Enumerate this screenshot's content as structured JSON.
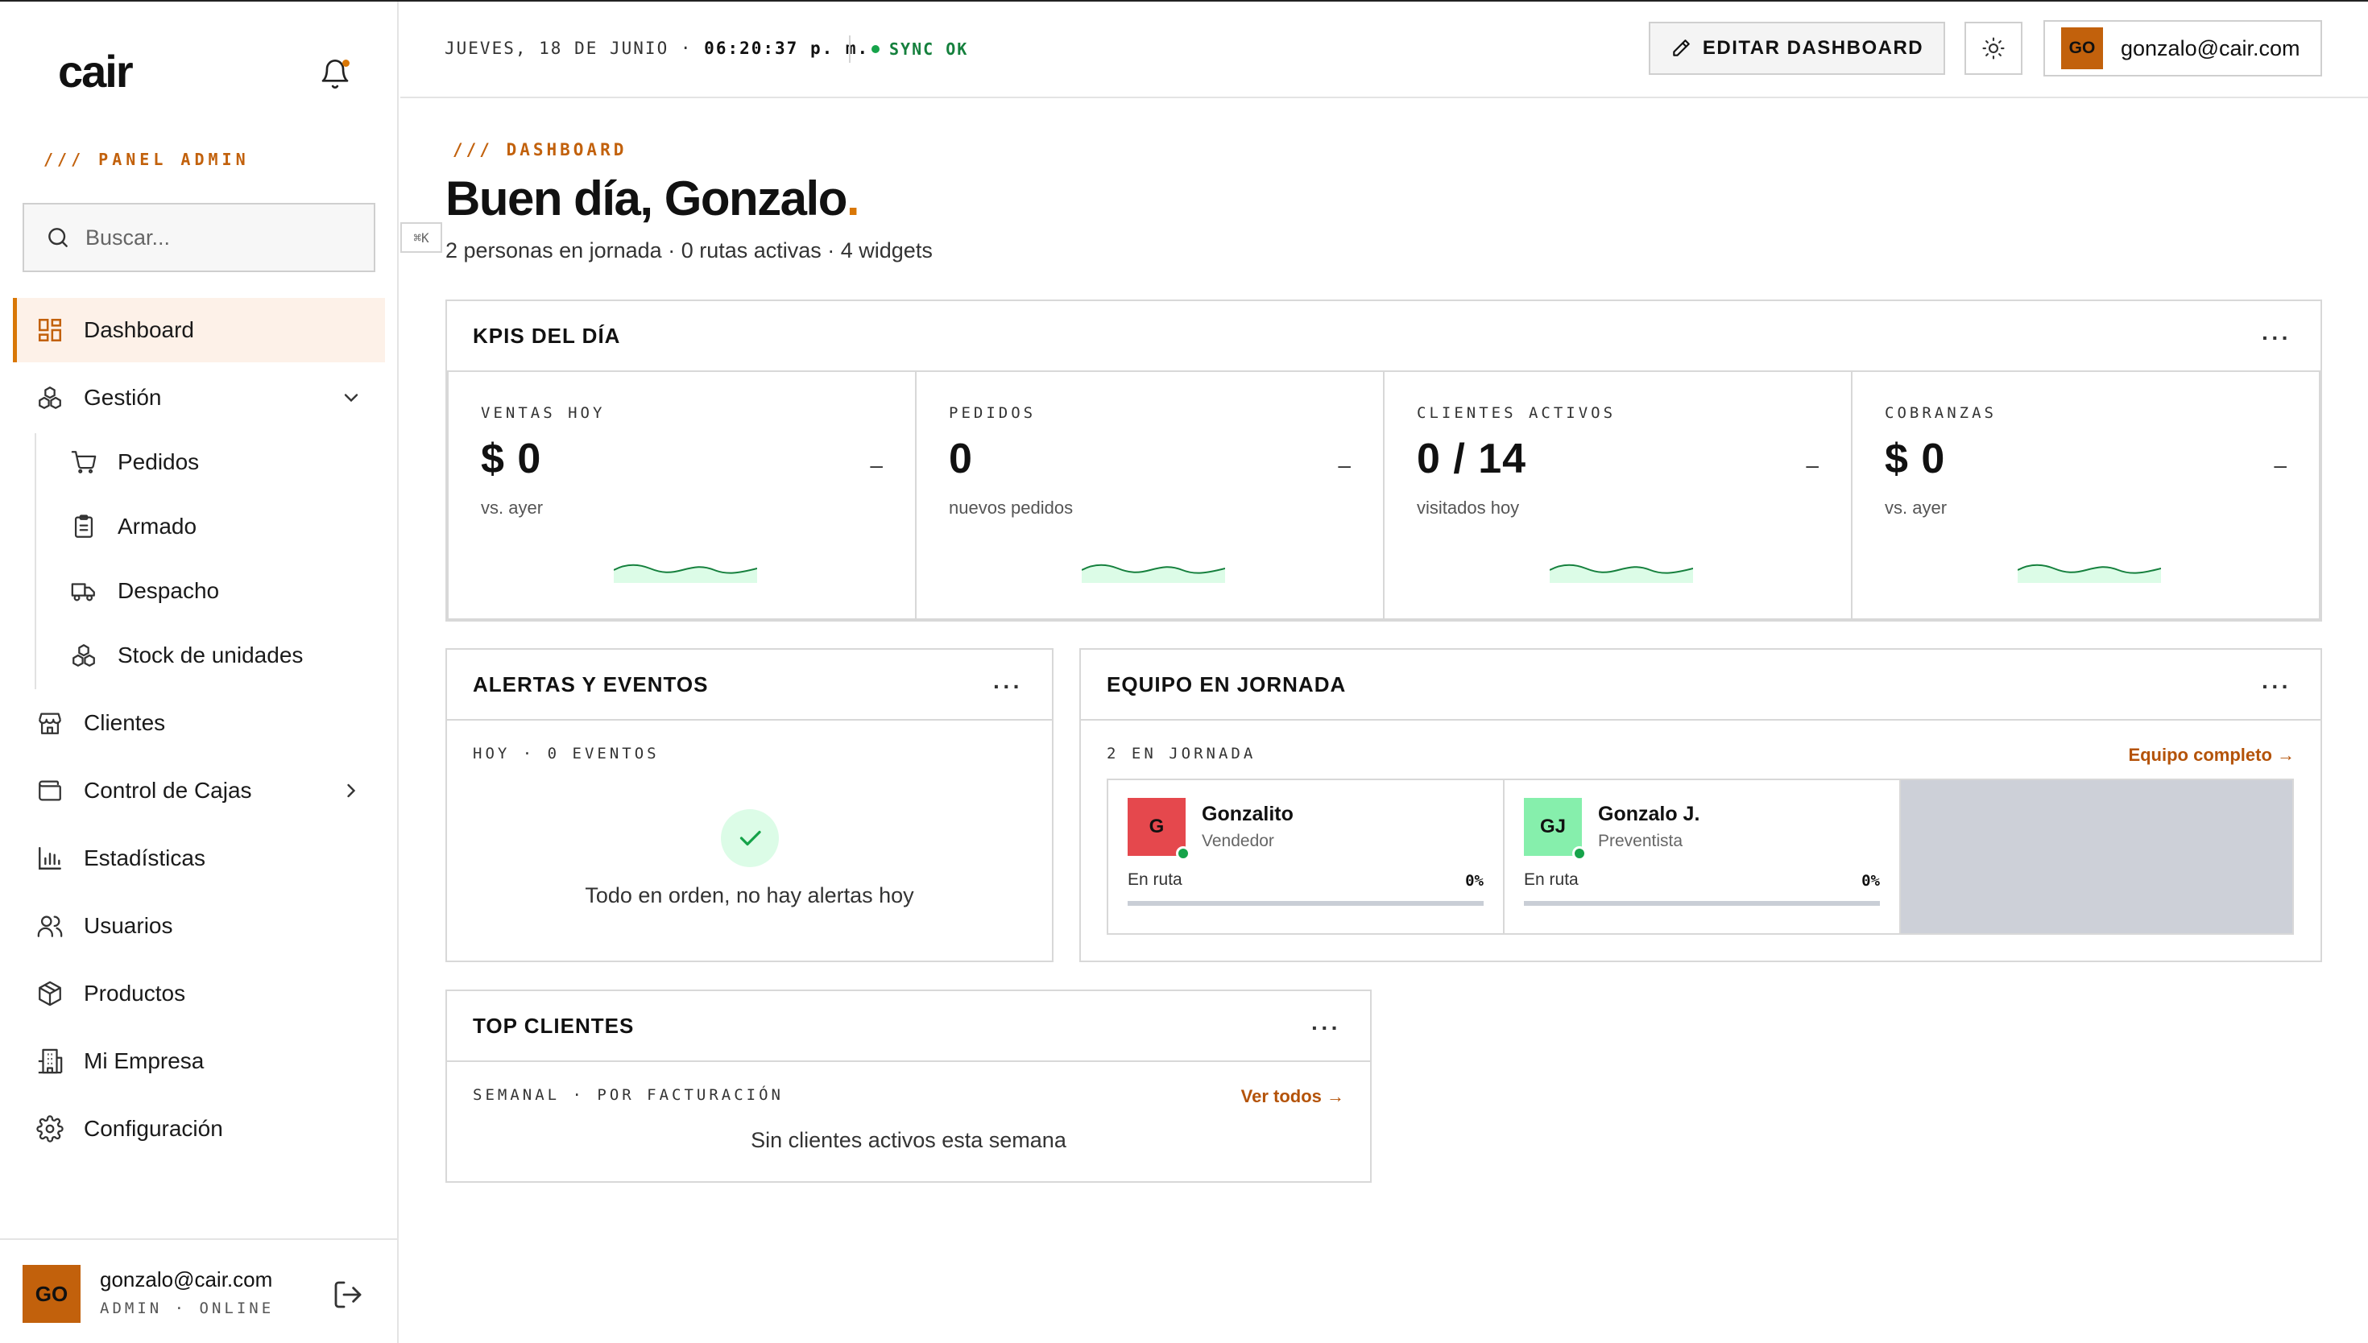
{
  "app": {
    "logo": "cair",
    "panel_label": "/// PANEL ADMIN",
    "accent": "#d97706"
  },
  "search": {
    "placeholder": "Buscar...",
    "shortcut": "⌘K"
  },
  "sidebar": {
    "items": [
      {
        "label": "Dashboard",
        "icon": "dashboard-icon",
        "active": true
      },
      {
        "label": "Gestión",
        "icon": "boxes-icon",
        "expanded": true
      },
      {
        "label": "Clientes",
        "icon": "store-icon"
      },
      {
        "label": "Control de Cajas",
        "icon": "wallet-icon"
      },
      {
        "label": "Estadísticas",
        "icon": "chart-icon"
      },
      {
        "label": "Usuarios",
        "icon": "users-icon"
      },
      {
        "label": "Productos",
        "icon": "package-icon"
      },
      {
        "label": "Mi Empresa",
        "icon": "building-icon"
      },
      {
        "label": "Configuración",
        "icon": "gear-icon"
      }
    ],
    "sub_items": [
      {
        "label": "Pedidos",
        "icon": "cart-icon"
      },
      {
        "label": "Armado",
        "icon": "clipboard-icon"
      },
      {
        "label": "Despacho",
        "icon": "truck-icon"
      },
      {
        "label": "Stock de unidades",
        "icon": "boxes-icon"
      }
    ],
    "footer": {
      "avatar": "GO",
      "email": "gonzalo@cair.com",
      "role": "ADMIN · ONLINE"
    }
  },
  "header": {
    "date": "JUEVES, 18 DE JUNIO ·",
    "time": "06:20:37 p. m.",
    "sync": "SYNC OK",
    "edit_button": "EDITAR DASHBOARD",
    "user_avatar": "GO",
    "user_email": "gonzalo@cair.com"
  },
  "main": {
    "breadcrumb": "/// DASHBOARD",
    "greeting": "Buen día, Gonzalo",
    "greeting_dot": ".",
    "summary": "2 personas en jornada · 0 rutas activas · 4 widgets"
  },
  "kpis": {
    "title": "KPIS DEL DÍA",
    "more": "···",
    "items": [
      {
        "label": "VENTAS HOY",
        "value": "$ 0",
        "trend": "–",
        "sub": "vs. ayer"
      },
      {
        "label": "PEDIDOS",
        "value": "0",
        "trend": "–",
        "sub": "nuevos pedidos"
      },
      {
        "label": "CLIENTES ACTIVOS",
        "value": "0 / 14",
        "trend": "–",
        "sub": "visitados hoy"
      },
      {
        "label": "COBRANZAS",
        "value": "$ 0",
        "trend": "–",
        "sub": "vs. ayer"
      }
    ],
    "spark_color": "#15803d"
  },
  "alerts": {
    "title": "ALERTAS Y EVENTOS",
    "more": "···",
    "label": "HOY · 0 EVENTOS",
    "empty": "Todo en orden, no hay alertas hoy"
  },
  "team": {
    "title": "EQUIPO EN JORNADA",
    "more": "···",
    "label": "2 EN JORNADA",
    "link": "Equipo completo →",
    "members": [
      {
        "initials": "G",
        "name": "Gonzalito",
        "role": "Vendedor",
        "status": "En ruta",
        "progress": "0%",
        "color": "#e5484d"
      },
      {
        "initials": "GJ",
        "name": "Gonzalo J.",
        "role": "Preventista",
        "status": "En ruta",
        "progress": "0%",
        "color": "#86efac"
      }
    ]
  },
  "top_clients": {
    "title": "TOP CLIENTES",
    "more": "···",
    "label": "SEMANAL · POR FACTURACIÓN",
    "link": "Ver todos →",
    "empty": "Sin clientes activos esta semana"
  }
}
